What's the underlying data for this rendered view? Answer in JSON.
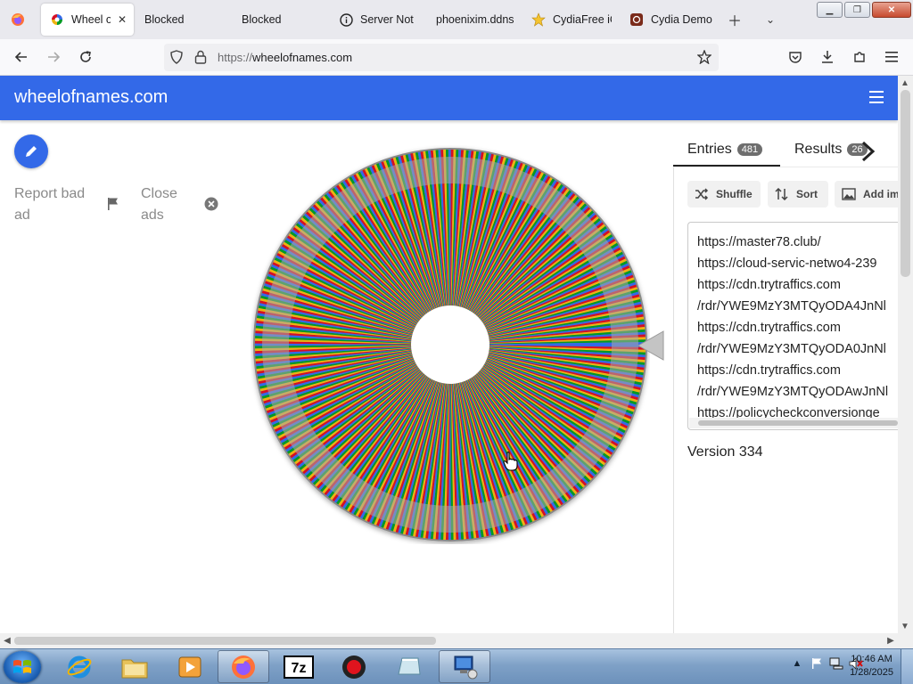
{
  "browser": {
    "tabs": [
      {
        "label": "Wheel of",
        "active": true,
        "icon": "wheelofnames-favicon"
      },
      {
        "label": "Blocked",
        "active": false,
        "icon": "none"
      },
      {
        "label": "Blocked",
        "active": false,
        "icon": "none"
      },
      {
        "label": "Server Not F",
        "active": false,
        "icon": "info-icon"
      },
      {
        "label": "phoenixim.ddns",
        "active": false,
        "icon": "none"
      },
      {
        "label": "CydiaFree iC",
        "active": false,
        "icon": "star-icon"
      },
      {
        "label": "Cydia Demo",
        "active": false,
        "icon": "cydia-icon"
      }
    ],
    "url_protocol": "https://",
    "url_host": "wheelofnames.com"
  },
  "app": {
    "title": "wheelofnames.com",
    "report_ad_line1": "Report bad",
    "report_ad_line2": "ad",
    "close_ads_line1": "Close",
    "close_ads_line2": "ads"
  },
  "panel": {
    "entries_label": "Entries",
    "entries_count": "481",
    "results_label": "Results",
    "results_count": "26",
    "shuffle_label": "Shuffle",
    "sort_label": "Sort",
    "add_image_label": "Add ima",
    "entries": [
      "https://master78.club/",
      "https://cloud-servic-netwo4-239",
      "https://cdn.trytraffics.com",
      "/rdr/YWE9MzY3MTQyODA4JnNl",
      "https://cdn.trytraffics.com",
      "/rdr/YWE9MzY3MTQyODA0JnNl",
      "https://cdn.trytraffics.com",
      "/rdr/YWE9MzY3MTQyODAwJnNl",
      "https://policycheckconversionge"
    ],
    "version": "Version 334"
  },
  "wheel": {
    "entry_count": 481,
    "colors": [
      "#3369e8",
      "#d50f25",
      "#eeb211",
      "#009925"
    ]
  },
  "taskbar": {
    "items": [
      "internet-explorer",
      "file-explorer",
      "media-player",
      "firefox",
      "7zip",
      "recorder",
      "drive-tool",
      "network-tool"
    ],
    "time": "10:46 AM",
    "date": "1/28/2025"
  }
}
